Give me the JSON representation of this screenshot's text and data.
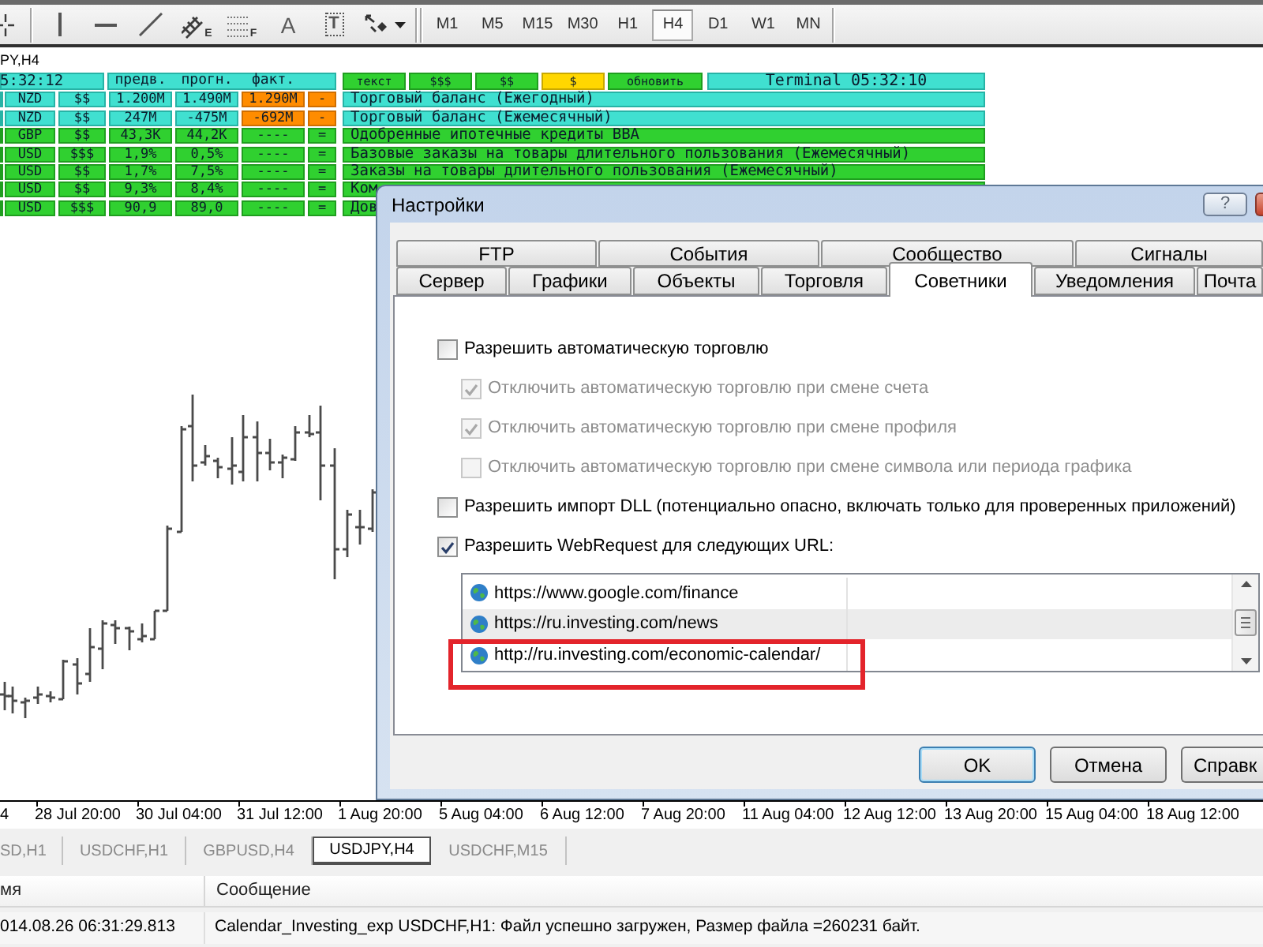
{
  "toolbar": {
    "tools": [
      {
        "kind": "crosshair"
      },
      {
        "kind": "vline"
      },
      {
        "kind": "hline"
      },
      {
        "kind": "trendline"
      },
      {
        "kind": "channel",
        "glyph": "E"
      },
      {
        "kind": "fibo",
        "glyph": "F"
      },
      {
        "kind": "text",
        "glyph": "A"
      },
      {
        "kind": "label",
        "glyph": "T"
      },
      {
        "kind": "arrows"
      }
    ],
    "timeframes": [
      {
        "label": "M1",
        "selected": false
      },
      {
        "label": "M5",
        "selected": false
      },
      {
        "label": "M15",
        "selected": false
      },
      {
        "label": "M30",
        "selected": false
      },
      {
        "label": "H1",
        "selected": false
      },
      {
        "label": "H4",
        "selected": true
      },
      {
        "label": "D1",
        "selected": false
      },
      {
        "label": "W1",
        "selected": false
      },
      {
        "label": "MN",
        "selected": false
      }
    ]
  },
  "chart": {
    "title": "PY,H4",
    "time_axis": [
      "4",
      "28 Jul 20:00",
      "30 Jul 04:00",
      "31 Jul 12:00",
      "1 Aug 20:00",
      "5 Aug 04:00",
      "6 Aug 12:00",
      "7 Aug 20:00",
      "11 Aug 04:00",
      "12 Aug 12:00",
      "13 Aug 20:00",
      "15 Aug 04:00",
      "18 Aug 12:00"
    ]
  },
  "news_panel": {
    "clock": "5:32:12",
    "columns": [
      "предв.",
      "прогн.",
      "факт."
    ],
    "filters": [
      {
        "label": "текст",
        "selected": false
      },
      {
        "label": "$$$",
        "selected": false
      },
      {
        "label": "$$",
        "selected": false
      },
      {
        "label": "$",
        "selected": true
      }
    ],
    "refresh": "обновить",
    "terminal_time": "Terminal 05:32:10",
    "rows": [
      {
        "currency": "NZD",
        "importance": "$$",
        "previous": "1.200M",
        "forecast": "1.490M",
        "actual": "1.290M",
        "sign": "-",
        "event": "Торговый баланс (Ежегодный)",
        "released": true
      },
      {
        "currency": "NZD",
        "importance": "$$",
        "previous": "247M",
        "forecast": "-475M",
        "actual": "-692M",
        "sign": "-",
        "event": "Торговый баланс (Ежемесячный)",
        "released": true
      },
      {
        "currency": "GBP",
        "importance": "$$",
        "previous": "43,3K",
        "forecast": "44,2K",
        "actual": "----",
        "sign": "=",
        "event": "Одобренные ипотечные кредиты BBA",
        "released": false
      },
      {
        "currency": "USD",
        "importance": "$$$",
        "previous": "1,9%",
        "forecast": "0,5%",
        "actual": "----",
        "sign": "=",
        "event": "Базовые заказы на товары длительного пользования (Ежемесячный)",
        "released": false
      },
      {
        "currency": "USD",
        "importance": "$$",
        "previous": "1,7%",
        "forecast": "7,5%",
        "actual": "----",
        "sign": "=",
        "event": "Заказы на товары длительного пользования (Ежемесячный)",
        "released": false
      },
      {
        "currency": "USD",
        "importance": "$$",
        "previous": "9,3%",
        "forecast": "8,4%",
        "actual": "----",
        "sign": "=",
        "event": "Ком",
        "released": false
      },
      {
        "currency": "USD",
        "importance": "$$$",
        "previous": "90,9",
        "forecast": "89,0",
        "actual": "----",
        "sign": "=",
        "event": "Дов",
        "released": false
      }
    ]
  },
  "dialog": {
    "title": "Настройки",
    "help": "?",
    "tab_rows": [
      [
        {
          "label": "FTP",
          "selected": false
        },
        {
          "label": "События",
          "selected": false
        },
        {
          "label": "Сообщество",
          "selected": false
        },
        {
          "label": "Сигналы",
          "selected": false
        }
      ],
      [
        {
          "label": "Сервер",
          "selected": false
        },
        {
          "label": "Графики",
          "selected": false
        },
        {
          "label": "Объекты",
          "selected": false
        },
        {
          "label": "Торговля",
          "selected": false
        },
        {
          "label": "Советники",
          "selected": true
        },
        {
          "label": "Уведомления",
          "selected": false
        },
        {
          "label": "Почта",
          "selected": false
        }
      ]
    ],
    "options": [
      {
        "label": "Разрешить автоматическую торговлю",
        "checked": false,
        "disabled": false,
        "children": [
          {
            "label": "Отключить автоматическую торговлю при смене счета",
            "checked": true,
            "disabled": true
          },
          {
            "label": "Отключить автоматическую торговлю при смене профиля",
            "checked": true,
            "disabled": true
          },
          {
            "label": "Отключить автоматическую торговлю при смене символа или периода графика",
            "checked": false,
            "disabled": true
          }
        ]
      },
      {
        "label": "Разрешить импорт DLL (потенциально опасно, включать только для проверенных приложений)",
        "checked": false,
        "disabled": false
      },
      {
        "label": "Разрешить WebRequest для следующих URL:",
        "checked": true,
        "disabled": false
      }
    ],
    "url_list": [
      {
        "url": "https://www.google.com/finance",
        "selected": false,
        "highlighted": false
      },
      {
        "url": "https://ru.investing.com/news",
        "selected": true,
        "highlighted": false
      },
      {
        "url": "http://ru.investing.com/economic-calendar/",
        "selected": false,
        "highlighted": true
      }
    ],
    "buttons": [
      {
        "label": "OK",
        "default": true
      },
      {
        "label": "Отмена",
        "default": false
      },
      {
        "label": "Справк",
        "default": false
      }
    ]
  },
  "chart_tabs": [
    {
      "label": "SD,H1",
      "selected": false
    },
    {
      "label": "USDCHF,H1",
      "selected": false
    },
    {
      "label": "GBPUSD,H4",
      "selected": false
    },
    {
      "label": "USDJPY,H4",
      "selected": true
    },
    {
      "label": "USDCHF,M15",
      "selected": false
    }
  ],
  "log": {
    "columns": [
      "мя",
      "Сообщение"
    ],
    "rows": [
      {
        "time": "014.08.26 06:31:29.813",
        "message": "Calendar_Investing_exp USDCHF,H1: Файл успешно загружен, Размер файла =260231 байт."
      }
    ]
  }
}
